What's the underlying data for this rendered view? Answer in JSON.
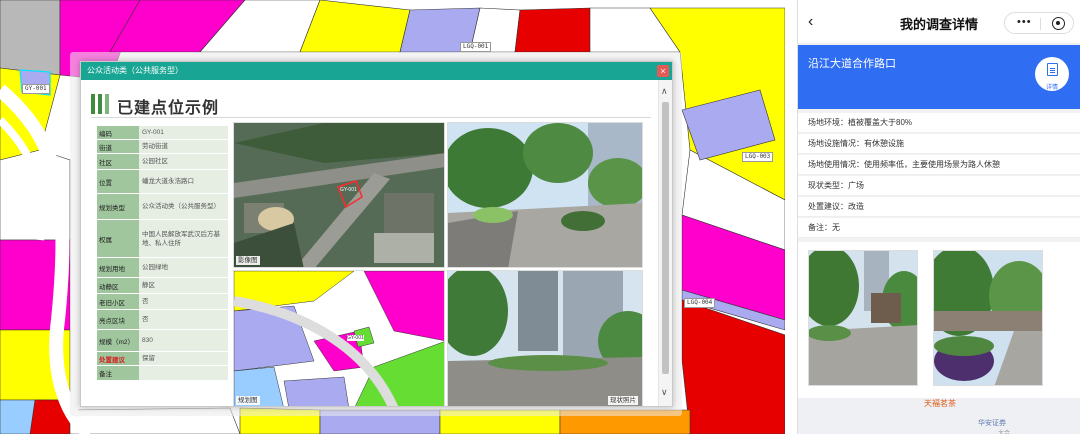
{
  "map": {
    "labels": [
      "GY-001",
      "LGQ-001",
      "LGQ-003",
      "LGQ-004"
    ]
  },
  "dialog": {
    "title": "公众活动类（公共服务型）",
    "close": "×",
    "section_title": "已建点位示例",
    "fields": [
      {
        "key": "编码",
        "value": "GY-001"
      },
      {
        "key": "街道",
        "value": "劳动街道"
      },
      {
        "key": "社区",
        "value": "公园社区"
      },
      {
        "key": "位置",
        "value": "蟠龙大道永浩路口"
      },
      {
        "key": "规划类型",
        "value": "公众活动类（公共服务型）"
      },
      {
        "key": "权属",
        "value": "中国人民解放军武汉后方基地、私人住所"
      },
      {
        "key": "规划用地",
        "value": "公园绿地"
      },
      {
        "key": "动静区",
        "value": "静区"
      },
      {
        "key": "老旧小区",
        "value": "否"
      },
      {
        "key": "亮点区块",
        "value": "否"
      },
      {
        "key": "规模（m2）",
        "value": "830"
      },
      {
        "key": "处置建议",
        "value": "保留"
      },
      {
        "key": "备注",
        "value": ""
      }
    ],
    "photo_captions": {
      "aerial": "影像图",
      "plan": "规划图",
      "site": "现状照片"
    },
    "aerial_label": "GY-001",
    "plan_label": "GY-001"
  },
  "phone": {
    "title": "我的调查详情",
    "back": "‹",
    "more": "•••",
    "hero_title": "沿江大道合作路口",
    "detail_label": "详情",
    "rows": [
      "场地环境：植被覆盖大于80%",
      "场地设施情况：有休憩设施",
      "场地使用情况：使用频率低，主要使用场景为路人休憩",
      "现状类型：广场",
      "处置建议：改造",
      "备注：无"
    ],
    "map_pois": [
      "天福茗茶",
      "华安证券",
      "大合"
    ]
  }
}
